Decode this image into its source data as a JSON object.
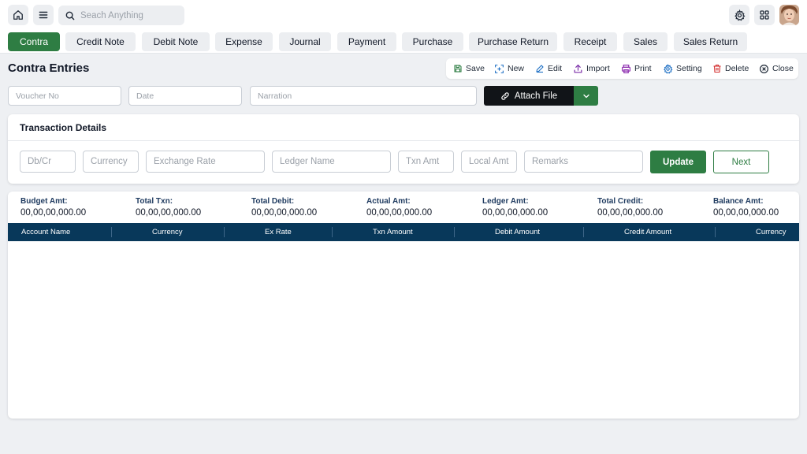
{
  "topbar": {
    "home_icon": "home-icon",
    "menu_icon": "hamburger-menu-icon",
    "search_placeholder": "Seach Anything",
    "settings_icon": "gear-icon",
    "apps_icon": "grid-icon"
  },
  "tabs": [
    {
      "label": "Contra",
      "active": true
    },
    {
      "label": "Credit Note"
    },
    {
      "label": "Debit Note"
    },
    {
      "label": "Expense"
    },
    {
      "label": "Journal"
    },
    {
      "label": "Payment"
    },
    {
      "label": "Purchase"
    },
    {
      "label": "Purchase Return"
    },
    {
      "label": "Receipt"
    },
    {
      "label": "Sales"
    },
    {
      "label": "Sales Return"
    }
  ],
  "page": {
    "title": "Contra Entries"
  },
  "toolbar": {
    "save": "Save",
    "new": "New",
    "edit": "Edit",
    "import": "Import",
    "print": "Print",
    "setting": "Setting",
    "delete": "Delete",
    "close": "Close"
  },
  "header_fields": {
    "voucher_placeholder": "Voucher No",
    "date_placeholder": "Date",
    "narration_placeholder": "Narration",
    "attach_label": "Attach File"
  },
  "transaction": {
    "title": "Transaction Details",
    "dbcr_placeholder": "Db/Cr",
    "currency_placeholder": "Currency",
    "exchange_rate_placeholder": "Exchange Rate",
    "ledger_name_placeholder": "Ledger Name",
    "txn_amt_placeholder": "Txn Amt",
    "local_amt_placeholder": "Local Amt",
    "remarks_placeholder": "Remarks",
    "update_label": "Update",
    "next_label": "Next"
  },
  "summary": [
    {
      "label": "Budget Amt:",
      "value": "00,00,00,000.00"
    },
    {
      "label": "Total Txn:",
      "value": "00,00,00,000.00"
    },
    {
      "label": "Total Debit:",
      "value": "00,00,00,000.00"
    },
    {
      "label": "Actual Amt:",
      "value": "00,00,00,000.00"
    },
    {
      "label": "Ledger Amt:",
      "value": "00,00,00,000.00"
    },
    {
      "label": "Total Credit:",
      "value": "00,00,00,000.00"
    },
    {
      "label": "Balance Amt:",
      "value": "00,00,00,000.00"
    }
  ],
  "table": {
    "columns": [
      "Account Name",
      "Currency",
      "Ex Rate",
      "Txn Amount",
      "Debit Amount",
      "Credit Amount",
      "Currency"
    ]
  },
  "colors": {
    "accent_green": "#2e7d43",
    "table_header": "#08385a",
    "attach_dark": "#111418"
  }
}
